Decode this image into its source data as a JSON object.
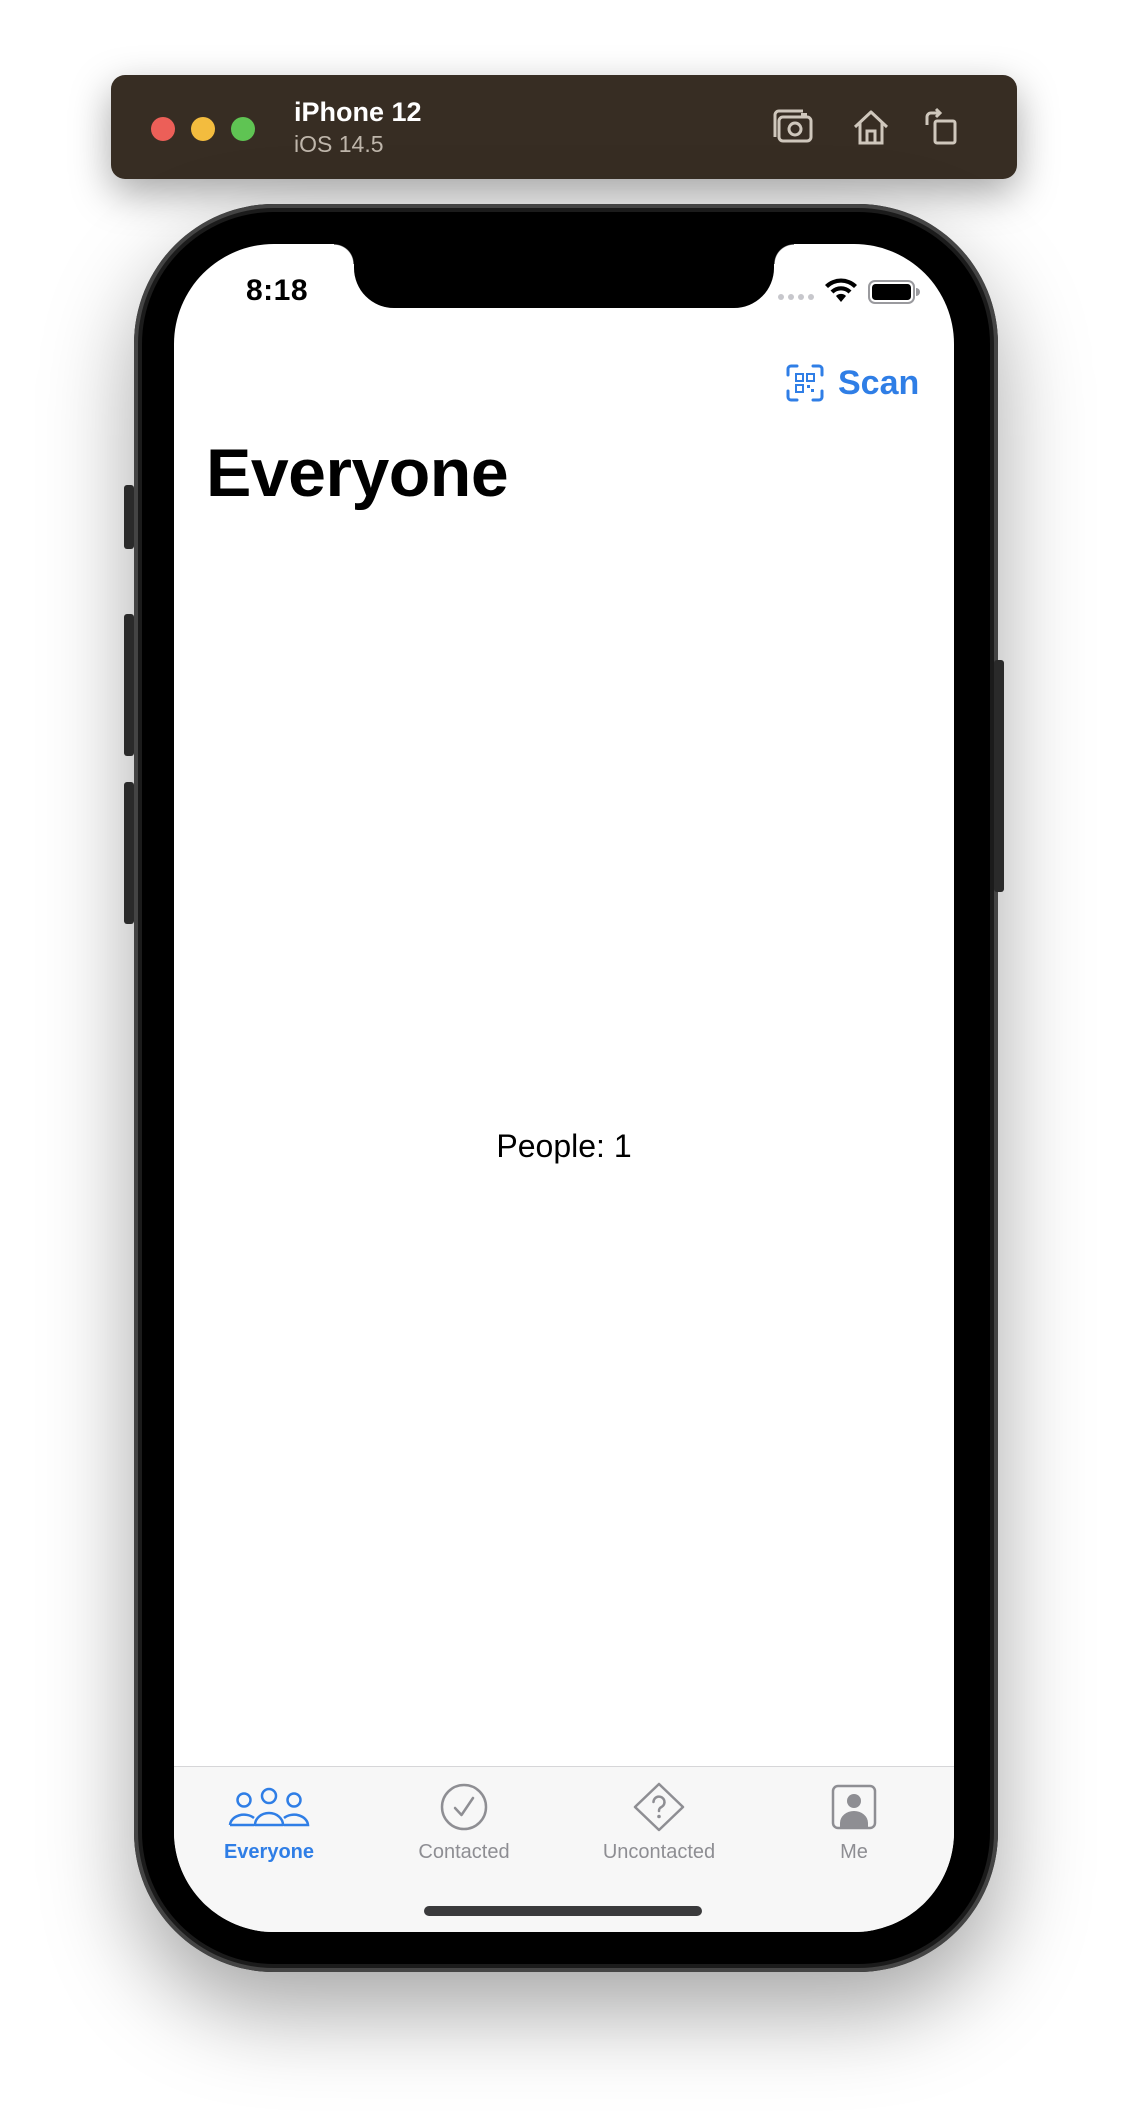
{
  "simulator": {
    "device_name": "iPhone 12",
    "os_version": "iOS 14.5",
    "tools": [
      "screenshot-icon",
      "home-icon",
      "rotate-icon"
    ]
  },
  "status_bar": {
    "time": "8:18"
  },
  "nav": {
    "scan_label": "Scan",
    "title": "Everyone"
  },
  "content": {
    "people_count": "People: 1"
  },
  "tab_bar": {
    "tabs": [
      {
        "label": "Everyone",
        "icon": "people-icon",
        "active": true
      },
      {
        "label": "Contacted",
        "icon": "checkmark-circle-icon",
        "active": false
      },
      {
        "label": "Uncontacted",
        "icon": "question-diamond-icon",
        "active": false
      },
      {
        "label": "Me",
        "icon": "person-square-icon",
        "active": false
      }
    ]
  },
  "colors": {
    "accent": "#2f7ee6",
    "inactive": "#8e8e93",
    "sim_bar": "#372d23"
  }
}
